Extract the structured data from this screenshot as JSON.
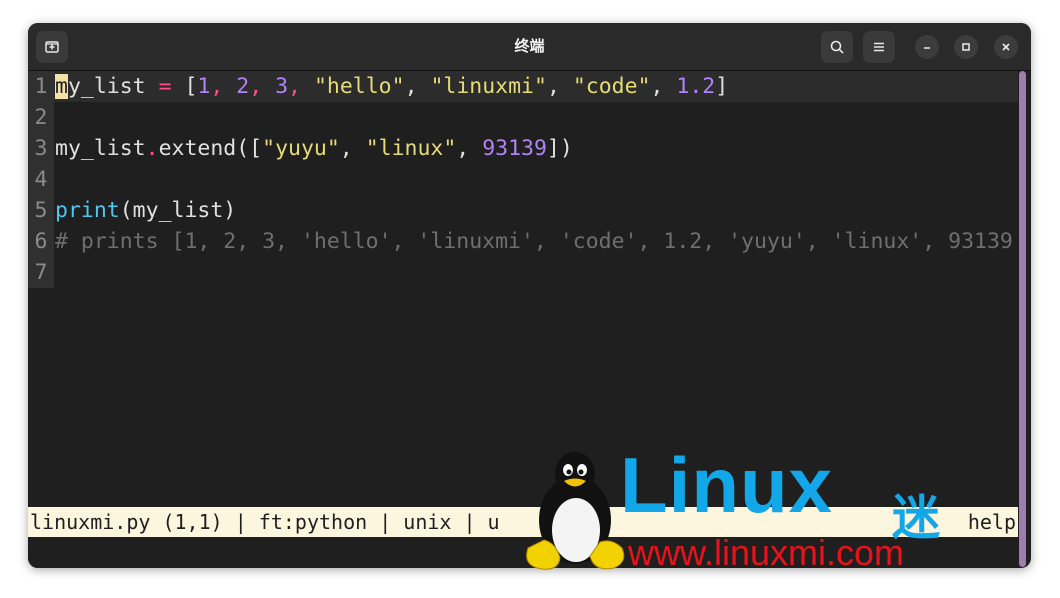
{
  "window": {
    "title": "终端"
  },
  "editor": {
    "lines": [
      {
        "num": "1"
      },
      {
        "num": "2"
      },
      {
        "num": "3"
      },
      {
        "num": "4"
      },
      {
        "num": "5"
      },
      {
        "num": "6"
      },
      {
        "num": "7"
      }
    ],
    "line1": {
      "cursor_char": "m",
      "t1": "y_list ",
      "t2": "=",
      "t3": " [",
      "n1": "1",
      "c1": ",",
      "n2": " 2",
      "c2": ",",
      "n3": " 3",
      "c3": ",",
      "s1": " \"hello\"",
      "p1": ", ",
      "s2": "\"linuxmi\"",
      "p2": ", ",
      "s3": "\"code\"",
      "p3": ", ",
      "n4": "1.2",
      "p4": "]"
    },
    "line3": {
      "t1": "my_list",
      "dot": ".",
      "t2": "extend([",
      "s1": "\"yuyu\"",
      "p1": ", ",
      "s2": "\"linux\"",
      "p2": ", ",
      "n1": "93139",
      "p3": "])"
    },
    "line5": {
      "fn": "print",
      "rest": "(my_list)"
    },
    "line6": {
      "comment": "# prints [1, 2, 3, 'hello', 'linuxmi', 'code', 1.2, 'yuyu', 'linux', 93139"
    }
  },
  "statusbar": {
    "left": "linuxmi.py (1,1) | ft:python | unix | u",
    "right": "help"
  },
  "watermark": {
    "brand": "Linux",
    "brand_suffix": "迷",
    "url": "www.linuxmi.com"
  },
  "colors": {
    "background": "#1f1f1f",
    "number": "#b084f5",
    "string": "#e6db74",
    "operator": "#ff4f86",
    "function": "#4fc6ee",
    "comment": "#6f6f6f",
    "statusbar": "#fdf6df",
    "cursor": "#f3e2a8"
  },
  "icons": {
    "new_tab": "new-tab-icon",
    "search": "search-icon",
    "menu": "hamburger-menu-icon",
    "minimize": "minimize-icon",
    "maximize": "maximize-icon",
    "close": "close-icon"
  }
}
